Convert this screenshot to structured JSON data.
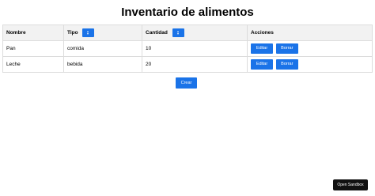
{
  "title": "Inventario de alimentos",
  "table": {
    "headers": {
      "nombre": "Nombre",
      "tipo": "Tipo",
      "cantidad": "Cantidad",
      "acciones": "Acciones"
    },
    "rows": [
      {
        "nombre": "Pan",
        "tipo": "comida",
        "cantidad": "10"
      },
      {
        "nombre": "Leche",
        "tipo": "bebida",
        "cantidad": "20"
      }
    ],
    "actions": {
      "edit_label": "Editar",
      "delete_label": "Borrar"
    }
  },
  "create_label": "Crear",
  "sandbox_label": "Open Sandbox",
  "colors": {
    "accent": "#1a73e8",
    "header_bg": "#f2f2f2",
    "sandbox_bg": "#111111"
  }
}
